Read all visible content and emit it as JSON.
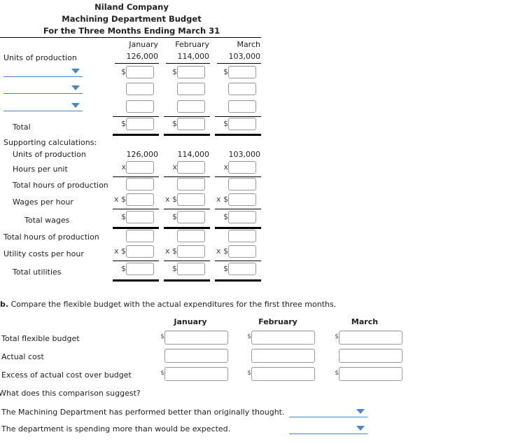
{
  "header": {
    "company": "Niland Company",
    "report": "Machining Department Budget",
    "period": "For the Three Months Ending March 31"
  },
  "budget": {
    "months": [
      "January",
      "February",
      "March"
    ],
    "units_label": "Units of production",
    "units": [
      "126,000",
      "114,000",
      "103,000"
    ],
    "cost_rows": [
      {
        "dropdown_value": "",
        "prefix": "$",
        "values": [
          "",
          "",
          ""
        ]
      },
      {
        "dropdown_value": "",
        "prefix": "",
        "values": [
          "",
          "",
          ""
        ]
      },
      {
        "dropdown_value": "",
        "prefix": "",
        "values": [
          "",
          "",
          ""
        ]
      }
    ],
    "total_label": "Total",
    "total_prefix": "$",
    "total_values": [
      "",
      "",
      ""
    ]
  },
  "supporting": {
    "title": "Supporting calculations:",
    "units_label": "Units of production",
    "units": [
      "126,000",
      "114,000",
      "103,000"
    ],
    "rows": [
      {
        "label": "Hours per unit",
        "prefix": "x",
        "values": [
          "",
          "",
          ""
        ]
      },
      {
        "label": "Total hours of production",
        "prefix": "",
        "values": [
          "",
          "",
          ""
        ]
      },
      {
        "label": "Wages per hour",
        "prefix": "x $",
        "values": [
          "",
          "",
          ""
        ]
      },
      {
        "label": "Total wages",
        "prefix": "$",
        "values": [
          "",
          "",
          ""
        ]
      },
      {
        "label": "Total hours of production",
        "prefix": "",
        "values": [
          "",
          "",
          ""
        ]
      },
      {
        "label": "Utility costs per hour",
        "prefix": "x $",
        "values": [
          "",
          "",
          ""
        ]
      },
      {
        "label": "Total utilities",
        "prefix": "$",
        "values": [
          "",
          "",
          ""
        ]
      }
    ]
  },
  "part_b": {
    "letter": "b.",
    "instruction": "Compare the flexible budget with the actual expenditures for the first three months.",
    "months": [
      "January",
      "February",
      "March"
    ],
    "rows": [
      {
        "label": "Total flexible budget",
        "prefix": "$",
        "values": [
          "",
          "",
          ""
        ]
      },
      {
        "label": "Actual cost",
        "prefix": "",
        "values": [
          "",
          "",
          ""
        ]
      },
      {
        "label": "Excess of actual cost over budget",
        "prefix": "$",
        "values": [
          "",
          "",
          ""
        ]
      }
    ],
    "question": "What does this comparison suggest?",
    "statements": [
      {
        "text": "The Machining Department has performed better than originally thought.",
        "answer": ""
      },
      {
        "text": "The department is spending more than would be expected.",
        "answer": ""
      }
    ]
  }
}
